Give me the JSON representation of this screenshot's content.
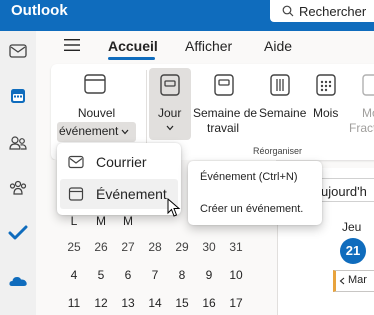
{
  "app": {
    "title": "Outlook"
  },
  "search": {
    "label": "Rechercher"
  },
  "ribbon_tabs": [
    {
      "label": "Accueil",
      "active": true
    },
    {
      "label": "Afficher",
      "active": false
    },
    {
      "label": "Aide",
      "active": false
    }
  ],
  "ribbon": {
    "new_event_line1": "Nouvel",
    "new_event_line2": "événement",
    "day_label": "Jour",
    "work_week_line1": "Semaine de",
    "work_week_line2": "travail",
    "week_label": "Semaine",
    "month_label": "Mois",
    "partial_label_1": "Mo",
    "partial_label_2": "Fract",
    "group_label": "Réorganiser"
  },
  "menu": {
    "items": [
      {
        "label": "Courrier",
        "icon": "mail-icon"
      },
      {
        "label": "Événement",
        "icon": "calendar-event-icon"
      }
    ]
  },
  "submenu": {
    "items": [
      {
        "label": "Événement (Ctrl+N)"
      },
      {
        "label": "Créer un événement."
      }
    ]
  },
  "mini_calendar": {
    "rows": [
      [
        "L",
        "M",
        "M"
      ],
      [
        "25",
        "26",
        "27",
        "28",
        "29",
        "30",
        "31"
      ],
      [
        "4",
        "5",
        "6",
        "7",
        "8",
        "9",
        "10"
      ],
      [
        "11",
        "12",
        "13",
        "14",
        "15",
        "16",
        "17"
      ]
    ]
  },
  "calendar_pane": {
    "today_partial": "ujourd'h",
    "day_of_week": "Jeu",
    "date": "21",
    "month_strip": "Mar"
  },
  "colors": {
    "brand": "#0f6cbd",
    "accent_strip": "#e8a33d"
  }
}
